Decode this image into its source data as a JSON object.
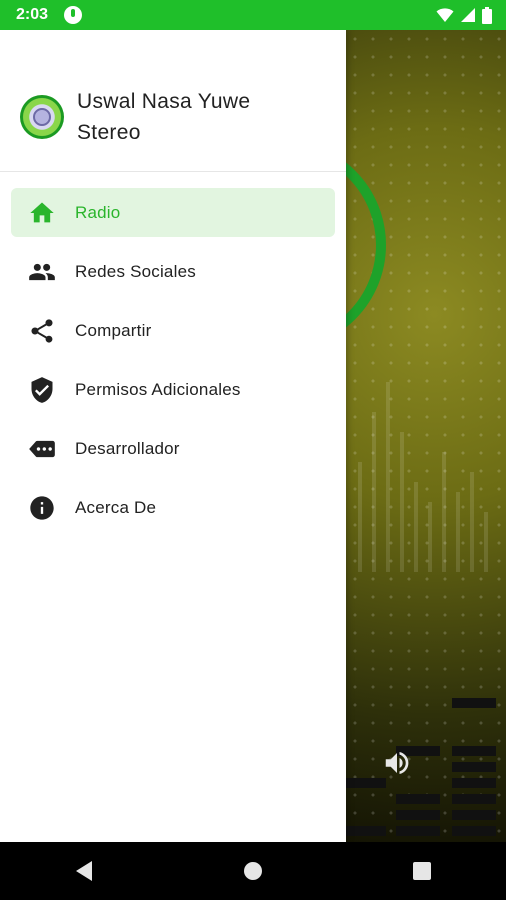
{
  "status_bar": {
    "time": "2:03",
    "icons": [
      "mic-icon",
      "wifi-icon",
      "cell-signal-icon",
      "battery-icon"
    ],
    "color": "#1fbf2a"
  },
  "drawer": {
    "app_title": "Uswal Nasa Yuwe Stereo",
    "logo": "station-logo",
    "accent_color": "#2ab52c",
    "items": [
      {
        "label": "Radio",
        "icon": "home-icon",
        "active": true
      },
      {
        "label": "Redes Sociales",
        "icon": "people-icon",
        "active": false
      },
      {
        "label": "Compartir",
        "icon": "share-icon",
        "active": false
      },
      {
        "label": "Permisos Adicionales",
        "icon": "shield-check-icon",
        "active": false
      },
      {
        "label": "Desarrollador",
        "icon": "label-dots-icon",
        "active": false
      },
      {
        "label": "Acerca De",
        "icon": "info-icon",
        "active": false
      }
    ]
  },
  "background": {
    "volume_icon": "volume-icon"
  },
  "nav_bar": {
    "buttons": [
      "back-icon",
      "home-circle-icon",
      "recents-icon"
    ]
  }
}
